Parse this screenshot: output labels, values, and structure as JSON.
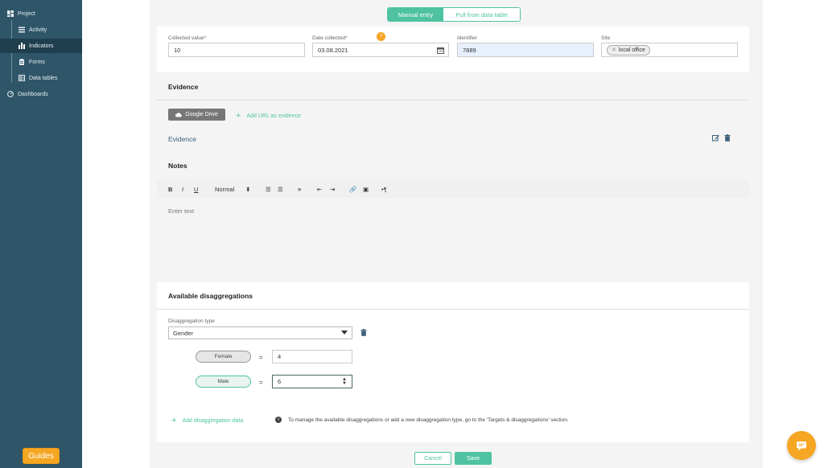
{
  "sidebar": {
    "items": [
      {
        "label": "Project",
        "icon": "grid-icon"
      },
      {
        "label": "Activity",
        "icon": "list-icon"
      },
      {
        "label": "Indicators",
        "icon": "bar-chart-icon"
      },
      {
        "label": "Forms",
        "icon": "clipboard-icon"
      },
      {
        "label": "Data tables",
        "icon": "table-icon"
      },
      {
        "label": "Dashboards",
        "icon": "gauge-icon"
      }
    ],
    "guides_label": "Guides"
  },
  "entry_mode": {
    "manual": "Manual entry",
    "pull": "Pull from data table"
  },
  "fields": {
    "collected_value": {
      "label": "Collected value*",
      "value": "10"
    },
    "date_collected": {
      "label": "Date collected*",
      "value": "03.08.2021",
      "help": "?"
    },
    "identifier": {
      "label": "Identifier",
      "value": "7889"
    },
    "site": {
      "label": "Site",
      "chip": "local office"
    }
  },
  "evidence": {
    "title": "Evidence",
    "gdrive_label": "Google Drive",
    "add_url_label": "Add URL as evidence",
    "item_label": "Evidence"
  },
  "notes": {
    "title": "Notes",
    "format_select": "Normal",
    "placeholder": "Enter text"
  },
  "disaggregations": {
    "title": "Available disaggregations",
    "type_label": "Disaggregation type",
    "type_value": "Gender",
    "rows": [
      {
        "label": "Female",
        "value": "4"
      },
      {
        "label": "Male",
        "value": "6"
      }
    ],
    "add_label": "Add disaggregation data",
    "info_text": "To manage the available disaggregations or add a new disaggregation type, go to the 'Targets & disaggregations' section."
  },
  "actions": {
    "cancel": "Cancel",
    "save": "Save"
  },
  "colors": {
    "accent": "#4fc3a1",
    "sidebar": "#2f5568",
    "warning": "#f5a623"
  }
}
